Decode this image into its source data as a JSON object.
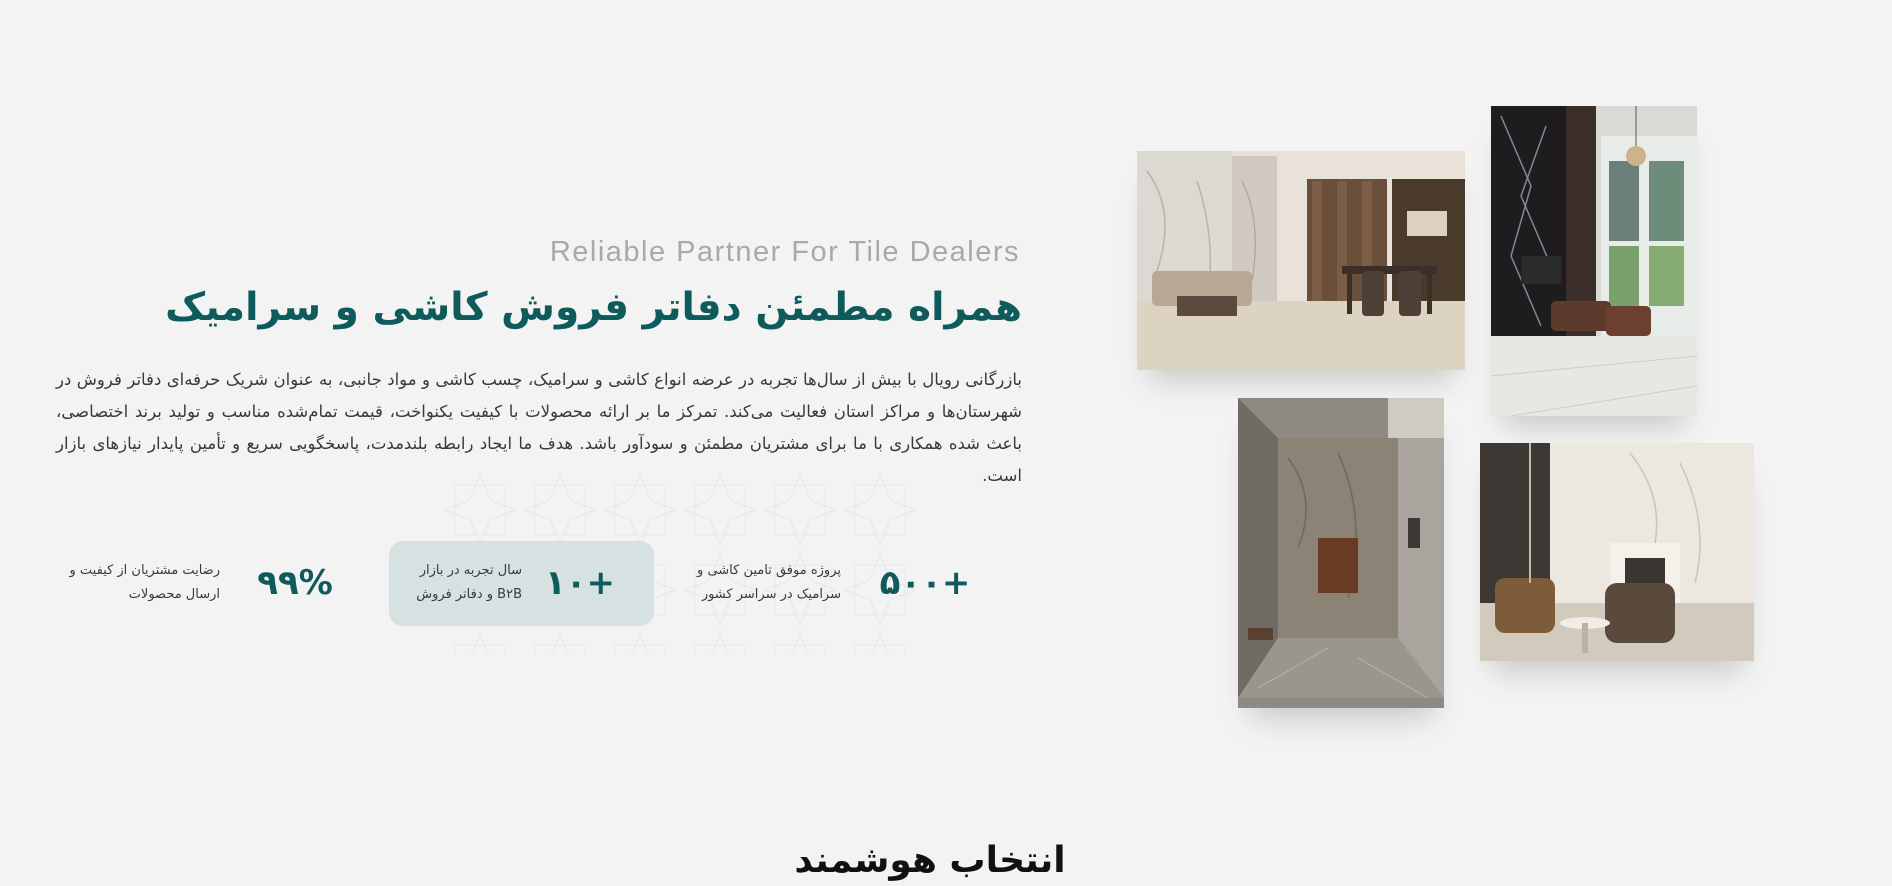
{
  "hero": {
    "subtitle_en": "Reliable Partner For Tile Dealers",
    "title": "همراه مطمئن دفاتر فروش کاشی و سرامیک",
    "paragraph": "بازرگانی رویال با بیش از سال‌ها تجربه در عرضه انواع کاشی و سرامیک، چسب کاشی و مواد جانبی، به عنوان شریک حرفه‌ای دفاتر فروش در شهرستان‌ها و مراکز استان فعالیت می‌کند. تمرکز ما بر ارائه محصولات با کیفیت یکنواخت، قیمت تمام‌شده مناسب و تولید برند اختصاصی، باعث شده همکاری با ما برای مشتریان مطمئن و سودآور باشد. هدف ما ایجاد رابطه بلندمدت، پاسخگویی سریع و تأمین پایدار نیازهای بازار است."
  },
  "stats": [
    {
      "value": "+۵۰۰",
      "label_line1": "پروژه موفق تامین کاشی و",
      "label_line2": "سرامیک در سراسر کشور"
    },
    {
      "value": "+۱۰",
      "label_line1": "سال تجربه در بازار",
      "label_line2": "B۲B و دفاتر فروش"
    },
    {
      "value": "۹۹%",
      "label_line1": "رضایت مشتریان از کیفیت و",
      "label_line2": "ارسال محصولات"
    }
  ],
  "gallery": [
    {
      "name": "living-dining-room-photo"
    },
    {
      "name": "black-marble-hall-photo"
    },
    {
      "name": "marble-corridor-photo"
    },
    {
      "name": "fireplace-lounge-photo"
    }
  ],
  "next_section": {
    "heading": "انتخاب هوشمند"
  },
  "colors": {
    "background": "#f3f3f3",
    "accent": "#0f5a5b",
    "highlight": "#d6e1e1",
    "muted_text": "#a9a9a9"
  }
}
